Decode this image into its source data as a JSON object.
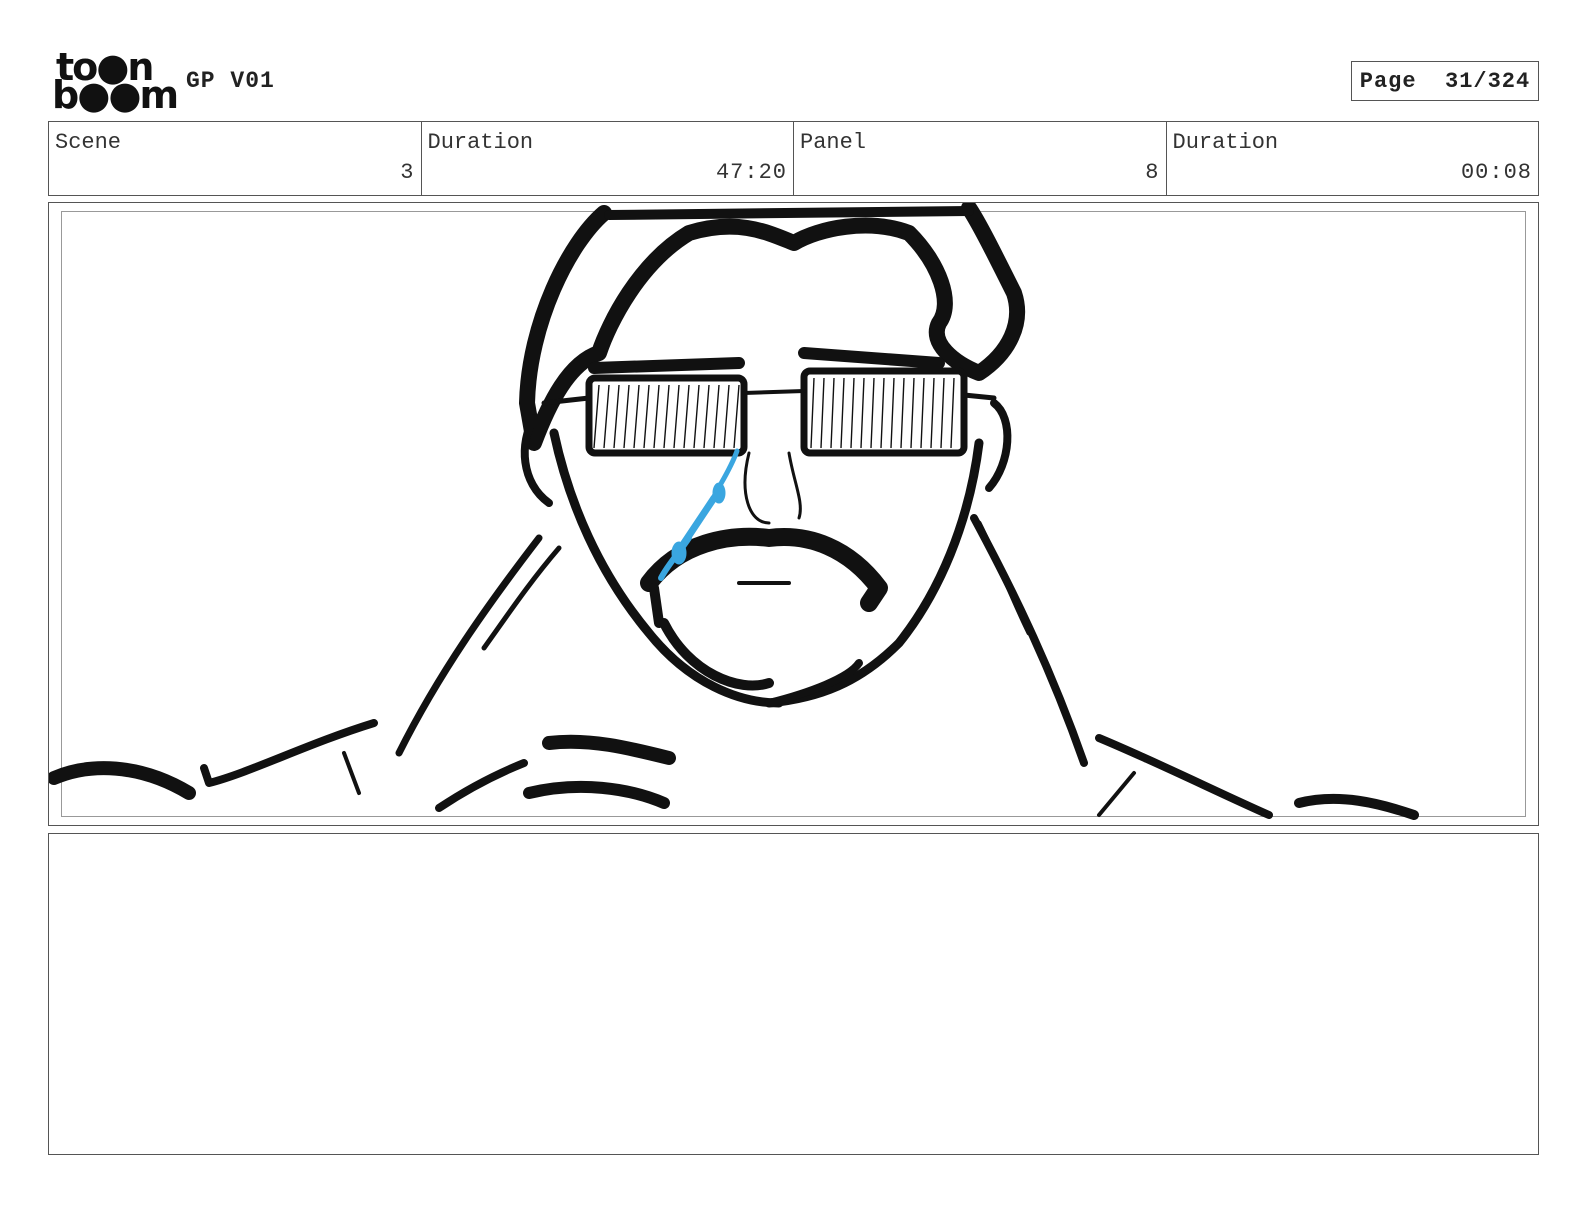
{
  "header": {
    "logo_line1": "to●n",
    "logo_line2": "b●●m",
    "project_title": "GP V01",
    "page_label": "Page",
    "page_number": "31/324"
  },
  "info": [
    {
      "label": "Scene",
      "value": "3"
    },
    {
      "label": "Duration",
      "value": "47:20"
    },
    {
      "label": "Panel",
      "value": "8"
    },
    {
      "label": "Duration",
      "value": "00:08"
    }
  ],
  "colors": {
    "ink": "#111111",
    "tear": "#3aa6e0",
    "border": "#555555"
  }
}
